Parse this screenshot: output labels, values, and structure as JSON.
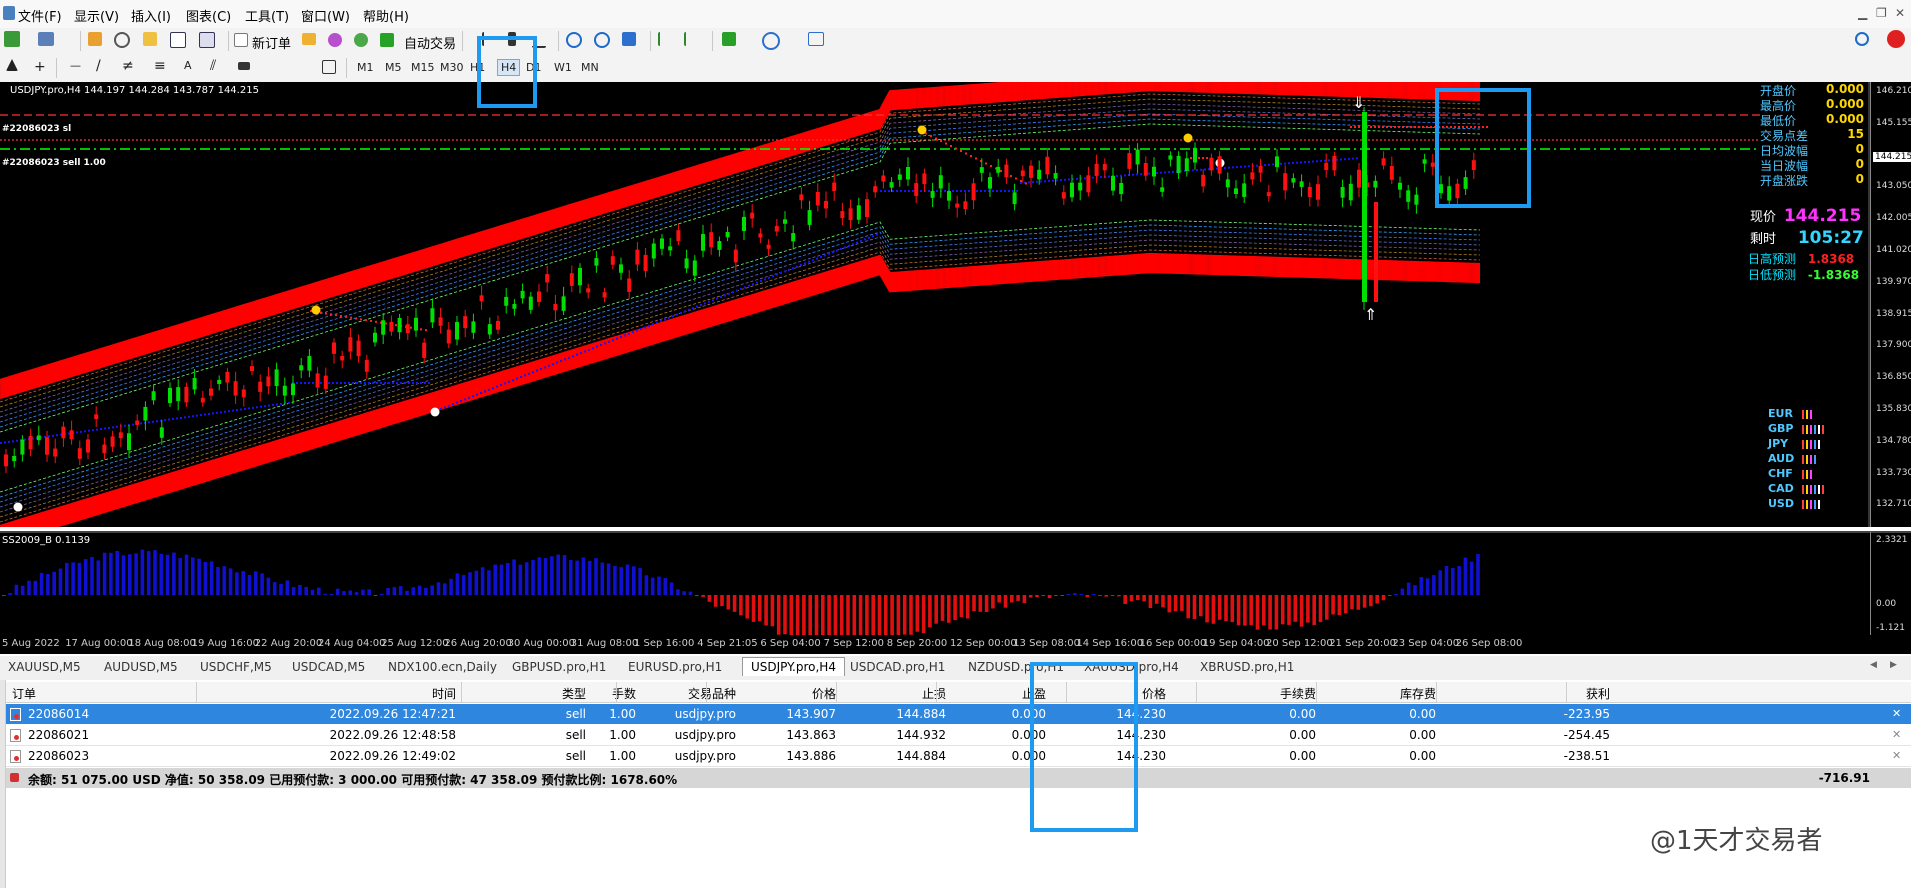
{
  "menu": [
    "文件(F)",
    "显示(V)",
    "插入(I)",
    "图表(C)",
    "工具(T)",
    "窗口(W)",
    "帮助(H)"
  ],
  "toolbar": {
    "new_order": "新订单",
    "auto_trade": "自动交易"
  },
  "timeframes": [
    "M1",
    "M5",
    "M15",
    "M30",
    "H1",
    "H4",
    "D1",
    "W1",
    "MN"
  ],
  "chart": {
    "header": "USDJPY.pro,H4  144.197 144.284 143.787 144.215",
    "order_label_sl": "#22086023 sl",
    "order_label_sell": "#22086023 sell 1.00",
    "indicator_label": "SS2009_B 0.1139",
    "colors": {
      "bg": "#000000",
      "bull": "#00e000",
      "bear": "#ff1010",
      "band": "#ff0000",
      "trend": "#1010ff",
      "current_price_line": "#00ff00"
    }
  },
  "info_panel": [
    {
      "label": "开盘价",
      "value": "0.000",
      "color": "#ffd700"
    },
    {
      "label": "最高价",
      "value": "0.000",
      "color": "#ffd700"
    },
    {
      "label": "最低价",
      "value": "0.000",
      "color": "#ffd700"
    },
    {
      "label": "交易点差",
      "value": "15",
      "color": "#ffd700"
    },
    {
      "label": "日均波幅",
      "value": "0",
      "color": "#ffd700"
    },
    {
      "label": "当日波幅",
      "value": "0",
      "color": "#ffd700"
    },
    {
      "label": "开盘涨跌",
      "value": "0",
      "color": "#ffd700"
    }
  ],
  "current_price": {
    "label": "现价",
    "value": "144.215"
  },
  "remaining_time": {
    "label": "剩时",
    "value": "105:27"
  },
  "forecast_high": {
    "label": "日高预测",
    "value": "1.8368"
  },
  "forecast_low": {
    "label": "日低预测",
    "value": "-1.8368"
  },
  "currencies": [
    "EUR",
    "GBP",
    "JPY",
    "AUD",
    "CHF",
    "CAD",
    "USD"
  ],
  "price_scale": [
    "146.210",
    "145.155",
    "144.215",
    "143.050",
    "142.005",
    "141.020",
    "139.970",
    "138.915",
    "137.900",
    "136.850",
    "135.830",
    "134.780",
    "133.730",
    "132.710"
  ],
  "indicator_scale": [
    "2.3321",
    "0.00",
    "-1.121"
  ],
  "time_labels": [
    "5 Aug 2022",
    "17 Aug 00:00",
    "18 Aug 08:00",
    "19 Aug 16:00",
    "22 Aug 20:00",
    "24 Aug 04:00",
    "25 Aug 12:00",
    "26 Aug 20:00",
    "30 Aug 00:00",
    "31 Aug 08:00",
    "1 Sep 16:00",
    "4 Sep 21:05",
    "6 Sep 04:00",
    "7 Sep 12:00",
    "8 Sep 20:00",
    "12 Sep 00:00",
    "13 Sep 08:00",
    "14 Sep 16:00",
    "16 Sep 00:00",
    "19 Sep 04:00",
    "20 Sep 12:00",
    "21 Sep 20:00",
    "23 Sep 04:00",
    "26 Sep 08:00"
  ],
  "chart_tabs": [
    "XAUUSD,M5",
    "AUDUSD,M5",
    "USDCHF,M5",
    "USDCAD,M5",
    "NDX100.ecn,Daily",
    "GBPUSD.pro,H1",
    "EURUSD.pro,H1",
    "USDJPY.pro,H4",
    "USDCAD.pro,H1",
    "NZDUSD.pro,H1",
    "XAUUSD.pro,H4",
    "XBRUSD.pro,H1"
  ],
  "table": {
    "headers": [
      "订单",
      "时间",
      "类型",
      "手数",
      "交易品种",
      "价格",
      "止损",
      "止盈",
      "价格",
      "手续费",
      "库存费",
      "获利"
    ],
    "rows": [
      [
        "22086014",
        "2022.09.26 12:47:21",
        "sell",
        "1.00",
        "usdjpy.pro",
        "143.907",
        "144.884",
        "0.000",
        "144.230",
        "0.00",
        "0.00",
        "-223.95"
      ],
      [
        "22086021",
        "2022.09.26 12:48:58",
        "sell",
        "1.00",
        "usdjpy.pro",
        "143.863",
        "144.932",
        "0.000",
        "144.230",
        "0.00",
        "0.00",
        "-254.45"
      ],
      [
        "22086023",
        "2022.09.26 12:49:02",
        "sell",
        "1.00",
        "usdjpy.pro",
        "143.886",
        "144.884",
        "0.000",
        "144.230",
        "0.00",
        "0.00",
        "-238.51"
      ]
    ],
    "summary": "余额: 51 075.00 USD  净值: 50 358.09  已用预付款: 3 000.00  可用预付款: 47 358.09  预付款比例: 1678.60%",
    "total": "-716.91"
  },
  "watermark": "@1天才交易者"
}
